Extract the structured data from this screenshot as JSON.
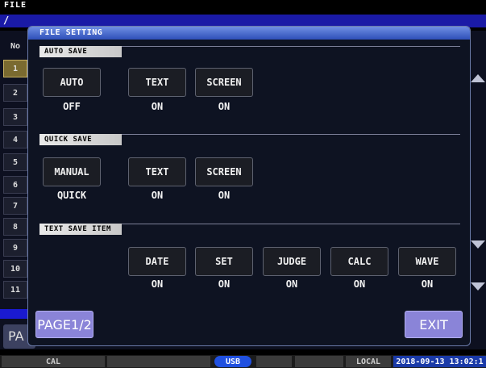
{
  "app": {
    "menu_title": "FILE",
    "path": "/",
    "list_header": "No",
    "row_numbers": [
      "1",
      "2",
      "3",
      "4",
      "5",
      "6",
      "7",
      "8",
      "9",
      "10",
      "11"
    ],
    "page_button_partial": "PA"
  },
  "dialog": {
    "title": "FILE SETTING",
    "auto_save": {
      "label": "AUTO SAVE",
      "buttons": [
        {
          "label": "AUTO",
          "value": "OFF"
        },
        {
          "label": "TEXT",
          "value": "ON"
        },
        {
          "label": "SCREEN",
          "value": "ON"
        }
      ]
    },
    "quick_save": {
      "label": "QUICK SAVE",
      "buttons": [
        {
          "label": "MANUAL",
          "value": "QUICK"
        },
        {
          "label": "TEXT",
          "value": "ON"
        },
        {
          "label": "SCREEN",
          "value": "ON"
        }
      ]
    },
    "text_save_item": {
      "label": "TEXT SAVE ITEM",
      "buttons": [
        {
          "label": "DATE",
          "value": "ON"
        },
        {
          "label": "SET",
          "value": "ON"
        },
        {
          "label": "JUDGE",
          "value": "ON"
        },
        {
          "label": "CALC",
          "value": "ON"
        },
        {
          "label": "WAVE",
          "value": "ON"
        }
      ]
    },
    "page_button": "PAGE1/2",
    "exit_button": "EXIT"
  },
  "status_bar": {
    "cal": "CAL",
    "usb": "USB",
    "local": "LOCAL",
    "datetime": "2018-09-13 13:02:1"
  }
}
